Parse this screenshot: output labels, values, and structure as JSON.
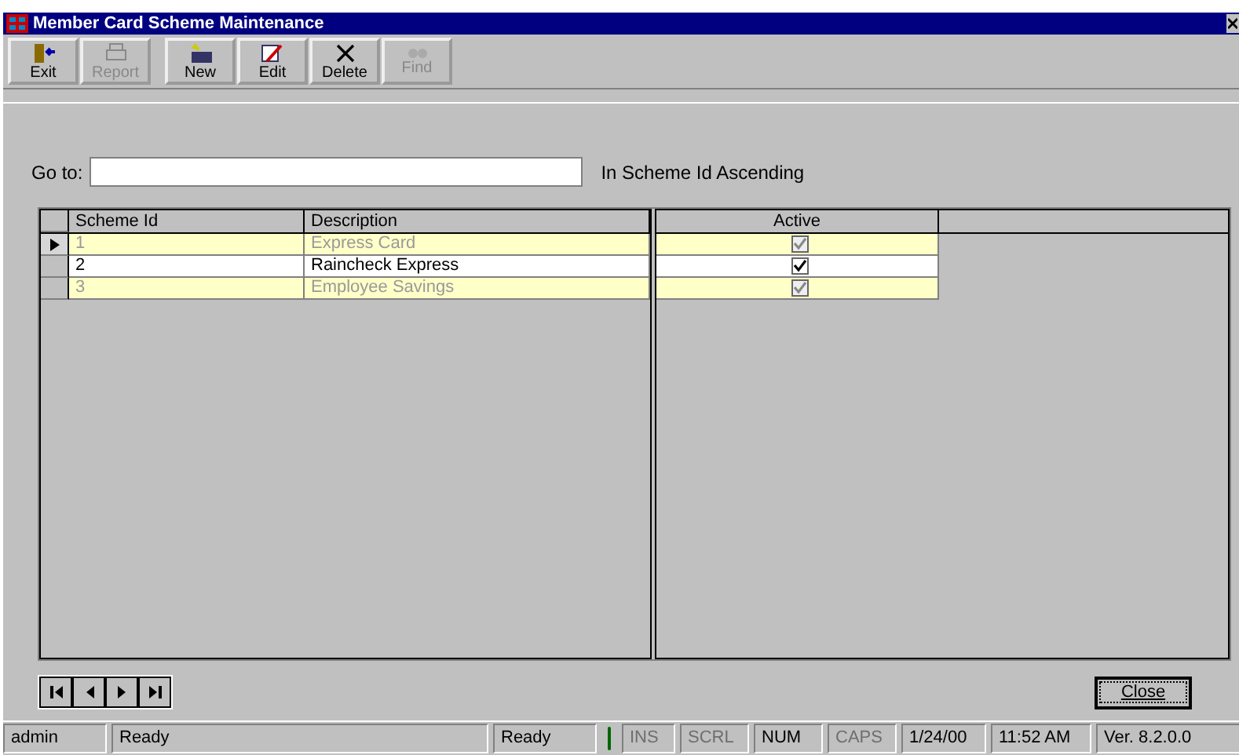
{
  "window": {
    "title": "Member Card Scheme Maintenance"
  },
  "toolbar": [
    {
      "label": "Exit",
      "kind": "exit",
      "disabled": false
    },
    {
      "label": "Report",
      "kind": "printer",
      "disabled": true
    },
    {
      "label": "New",
      "kind": "new",
      "disabled": false
    },
    {
      "label": "Edit",
      "kind": "edit",
      "disabled": false
    },
    {
      "label": "Delete",
      "kind": "delete",
      "disabled": false
    },
    {
      "label": "Find",
      "kind": "binoculars",
      "disabled": true
    }
  ],
  "goto": {
    "label": "Go to:",
    "order": "In Scheme Id Ascending"
  },
  "table": {
    "columns": [
      "Scheme Id",
      "Description",
      "Active"
    ],
    "rows": [
      {
        "id": "1",
        "description": "Express Card",
        "active": true,
        "dimmed": true,
        "selected": true
      },
      {
        "id": "2",
        "description": "Raincheck Express",
        "active": true,
        "dimmed": false,
        "selected": false
      },
      {
        "id": "3",
        "description": "Employee Savings",
        "active": true,
        "dimmed": true,
        "selected": false
      }
    ]
  },
  "close_button": "Close",
  "status_bar": [
    {
      "text": "admin",
      "disabled": false
    },
    {
      "text": "Ready",
      "disabled": false
    },
    {
      "text": "Ready",
      "disabled": false
    },
    {
      "text": "INS",
      "disabled": true
    },
    {
      "text": "SCRL",
      "disabled": true
    },
    {
      "text": "NUM",
      "disabled": false
    },
    {
      "text": "CAPS",
      "disabled": true
    },
    {
      "text": "1/24/00",
      "disabled": false
    },
    {
      "text": "11:52 AM",
      "disabled": false
    },
    {
      "text": "Ver. 8.2.0.0",
      "disabled": false
    }
  ]
}
